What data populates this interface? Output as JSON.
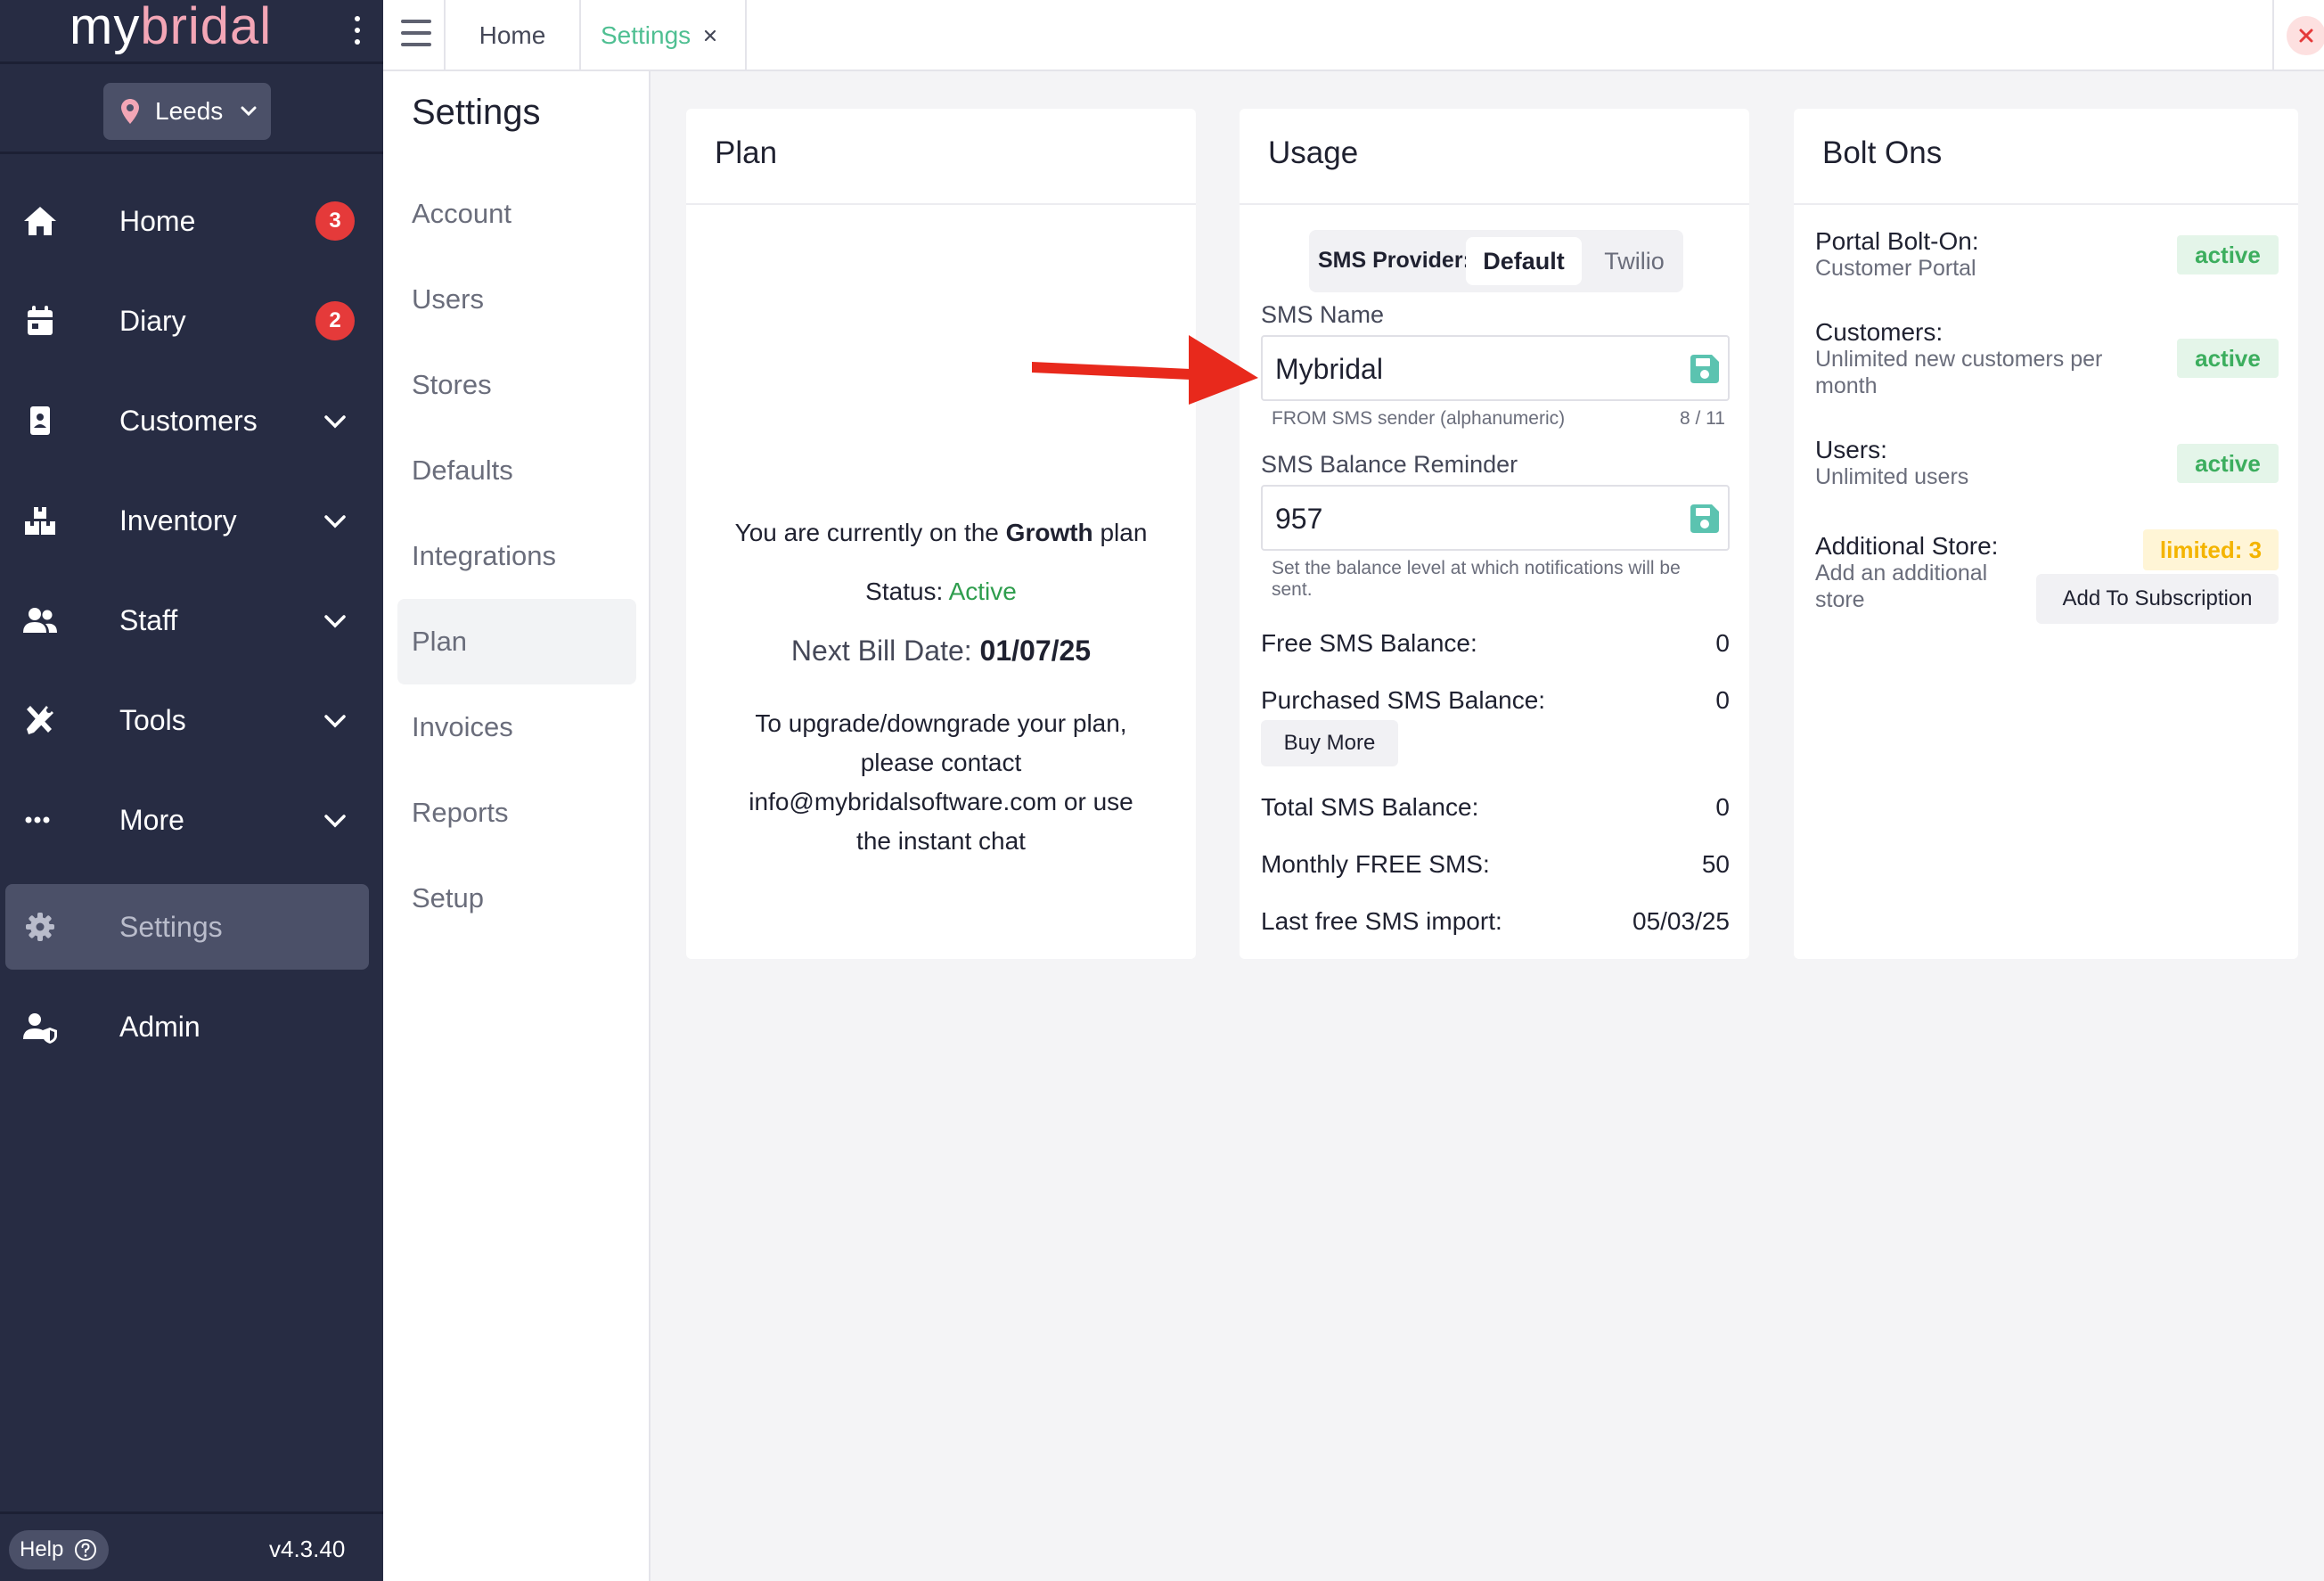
{
  "app": {
    "logo_my": "my",
    "logo_bridal": "bridal",
    "store": "Leeds",
    "version": "v4.3.40",
    "help": "Help"
  },
  "colors": {
    "sidebar_bg": "#272c43",
    "accent_green": "#4fbf92",
    "badge_red": "#e53a3a",
    "logo_pink": "#f3a6b6",
    "active_green": "#3cae5e",
    "limited_yellow": "#f4b400",
    "annotation_red": "#e8291c"
  },
  "sidebar": {
    "items": [
      {
        "label": "Home",
        "icon": "home-icon",
        "badge": "3"
      },
      {
        "label": "Diary",
        "icon": "calendar-icon",
        "badge": "2"
      },
      {
        "label": "Customers",
        "icon": "customer-card-icon"
      },
      {
        "label": "Inventory",
        "icon": "boxes-icon"
      },
      {
        "label": "Staff",
        "icon": "users-icon"
      },
      {
        "label": "Tools",
        "icon": "tools-icon"
      },
      {
        "label": "More",
        "icon": "ellipsis-icon"
      },
      {
        "label": "Settings",
        "icon": "gear-icon"
      },
      {
        "label": "Admin",
        "icon": "user-shield-icon"
      }
    ]
  },
  "tabs": {
    "home": "Home",
    "settings": "Settings"
  },
  "submenu": {
    "title": "Settings",
    "items": [
      "Account",
      "Users",
      "Stores",
      "Defaults",
      "Integrations",
      "Plan",
      "Invoices",
      "Reports",
      "Setup"
    ],
    "active": "Plan"
  },
  "plan": {
    "title": "Plan",
    "line_prefix": "You are currently on the ",
    "plan_name": "Growth",
    "line_suffix": " plan",
    "status_label": "Status: ",
    "status_value": "Active",
    "bill_label": "Next Bill Date: ",
    "bill_date": "01/07/25",
    "contact": "To upgrade/downgrade your plan, please contact info@mybridalsoftware.com or use the instant chat"
  },
  "usage": {
    "title": "Usage",
    "provider_label": "SMS Provider:",
    "provider_default": "Default",
    "provider_twilio": "Twilio",
    "sms_name_label": "SMS Name",
    "sms_name_value": "Mybridal",
    "sms_name_hint": "FROM SMS sender (alphanumeric)",
    "sms_name_count": "8 / 11",
    "reminder_label": "SMS Balance Reminder",
    "reminder_value": "957",
    "reminder_hint": "Set the balance level at which notifications will be sent.",
    "rows": [
      {
        "label": "Free SMS Balance:",
        "value": "0"
      },
      {
        "label": "Purchased SMS Balance:",
        "value": "0"
      },
      {
        "label": "Total SMS Balance:",
        "value": "0"
      },
      {
        "label": "Monthly FREE SMS:",
        "value": "50"
      },
      {
        "label": "Last free SMS import:",
        "value": "05/03/25"
      }
    ],
    "buy_more": "Buy More"
  },
  "bolt_ons": {
    "title": "Bolt Ons",
    "items": [
      {
        "name": "Portal Bolt-On:",
        "desc": "Customer Portal",
        "status": "active"
      },
      {
        "name": "Customers:",
        "desc": "Unlimited new customers per month",
        "status": "active"
      },
      {
        "name": "Users:",
        "desc": "Unlimited users",
        "status": "active"
      },
      {
        "name": "Additional Store:",
        "desc": "Add an additional store",
        "status": "limited: 3"
      }
    ],
    "add_button": "Add To Subscription"
  }
}
